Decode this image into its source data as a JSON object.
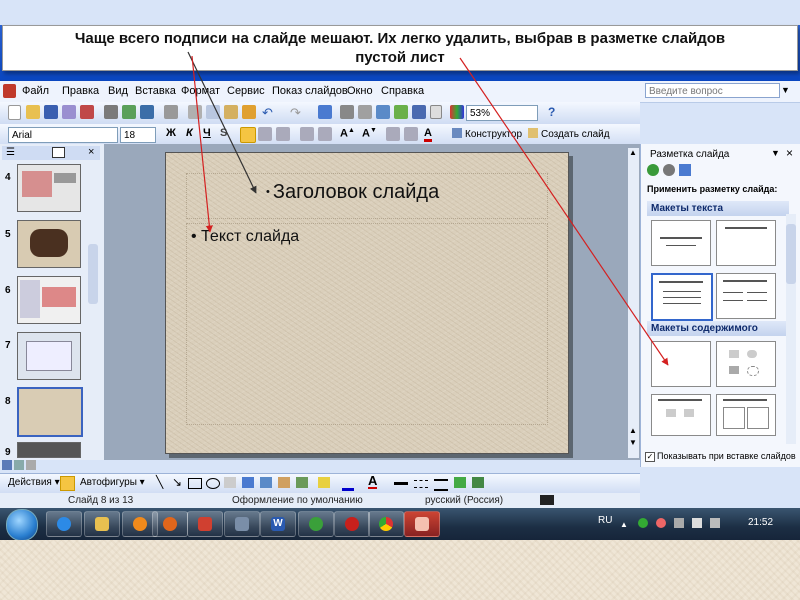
{
  "caption": {
    "line1": "Чаще всего подписи на слайде мешают. Их легко удалить, выбрав в разметке слайдов",
    "line2": "пустой лист"
  },
  "menubar": {
    "items": [
      "Файл",
      "Правка",
      "Вид",
      "Вставка",
      "Формат",
      "Сервис",
      "Показ слайдов",
      "Окно",
      "Справка"
    ],
    "ask_placeholder": "Введите вопрос"
  },
  "standard_toolbar": {
    "zoom": "53%"
  },
  "formatting_toolbar": {
    "font": "Arial",
    "size": "18",
    "bold": "Ж",
    "italic": "К",
    "underline": "Ч",
    "shadow": "S",
    "font_color": "A",
    "designer": "Конструктор",
    "new_slide": "Создать слайд"
  },
  "slides_panel": {
    "numbers": [
      "4",
      "5",
      "6",
      "7",
      "8",
      "9"
    ]
  },
  "slide": {
    "title": "Заголовок слайда",
    "body": "Текст слайда"
  },
  "task_pane": {
    "title": "Разметка слайда",
    "apply_label": "Применить разметку слайда:",
    "section_text": "Макеты текста",
    "section_content": "Макеты содержимого",
    "show_on_insert": "Показывать при вставке слайдов"
  },
  "draw_toolbar": {
    "actions": "Действия",
    "autoshapes": "Автофигуры"
  },
  "statusbar": {
    "slide_position": "Слайд 8 из 13",
    "design": "Оформление по умолчанию",
    "language": "русский (Россия)"
  },
  "taskbar": {
    "lang": "RU",
    "time": "21:52"
  },
  "colors": {
    "annotation_arrow": "#d42020",
    "pointer_arrow": "#333333",
    "selected_layout_border": "#3366cc"
  }
}
